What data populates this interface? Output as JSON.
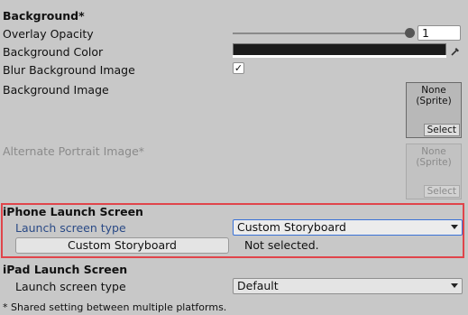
{
  "background": {
    "header": "Background*",
    "overlay_opacity_label": "Overlay Opacity",
    "overlay_opacity_value": "1",
    "overlay_opacity_fraction": 1.0,
    "background_color_label": "Background Color",
    "background_color": "#1b1b1b",
    "blur_label": "Blur Background Image",
    "blur_checked": true,
    "blur_check_glyph": "✓",
    "background_image_label": "Background Image",
    "background_image_value": "None\n(Sprite)",
    "background_image_value_line1": "None",
    "background_image_value_line2": "(Sprite)",
    "background_image_select": "Select",
    "alt_portrait_label": "Alternate Portrait Image*",
    "alt_portrait_value_line1": "None",
    "alt_portrait_value_line2": "(Sprite)",
    "alt_portrait_select": "Select"
  },
  "iphone": {
    "header": "iPhone Launch Screen",
    "launch_type_label": "Launch screen type",
    "launch_type_value": "Custom Storyboard",
    "storyboard_button": "Custom Storyboard",
    "storyboard_status": "Not selected."
  },
  "ipad": {
    "header": "iPad Launch Screen",
    "launch_type_label": "Launch screen type",
    "launch_type_value": "Default"
  },
  "footnote": "* Shared setting between multiple platforms.",
  "colors": {
    "highlight": "#e0454b",
    "focus": "#3a72d8",
    "link_label": "#2a4a86"
  }
}
